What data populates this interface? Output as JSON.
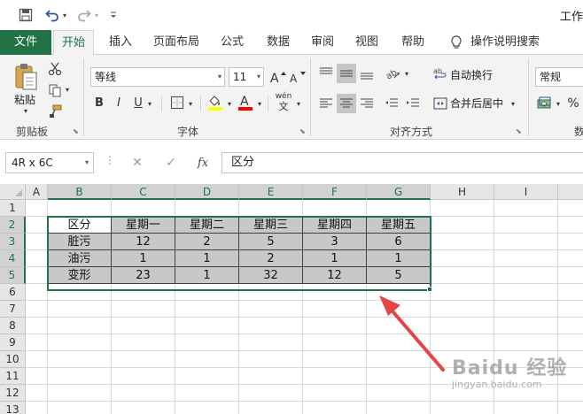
{
  "window": {
    "title": "工作"
  },
  "qat": {
    "save": "save-icon",
    "undo": "undo-icon",
    "redo": "redo-icon",
    "customize": "chevron-down-icon"
  },
  "tabs": [
    "文件",
    "开始",
    "插入",
    "页面布局",
    "公式",
    "数据",
    "审阅",
    "视图",
    "帮助",
    "操作说明搜索"
  ],
  "ribbon": {
    "clipboard": {
      "paste_label": "粘贴",
      "group_label": "剪贴板"
    },
    "font": {
      "font_name": "等线",
      "font_size": "11",
      "bold": "B",
      "italic": "I",
      "underline": "U",
      "phonetic": "wén",
      "phonetic_sub": "文",
      "group_label": "字体",
      "fill_color": "#ffff00",
      "font_color": "#ff0000"
    },
    "alignment": {
      "wrap_text": "自动换行",
      "merge_center": "合并后居中",
      "group_label": "对齐方式"
    },
    "number": {
      "format": "常规",
      "percent": "%",
      "group_label": "数"
    }
  },
  "formula_bar": {
    "name_box": "4R x 6C",
    "content": "区分",
    "fx": "fx"
  },
  "grid": {
    "columns": [
      "A",
      "B",
      "C",
      "D",
      "E",
      "F",
      "G",
      "H",
      "I"
    ],
    "rows": [
      "1",
      "2",
      "3",
      "4",
      "5",
      "6",
      "7",
      "8",
      "9",
      "10",
      "11",
      "12",
      "13"
    ],
    "table": {
      "header": [
        "区分",
        "星期一",
        "星期二",
        "星期三",
        "星期四",
        "星期五"
      ],
      "body": [
        [
          "脏污",
          "12",
          "2",
          "5",
          "3",
          "6"
        ],
        [
          "油污",
          "1",
          "1",
          "2",
          "1",
          "1"
        ],
        [
          "变形",
          "23",
          "1",
          "32",
          "12",
          "5"
        ]
      ]
    }
  },
  "watermark": {
    "text": "Baidu 经验",
    "sub": "jingyan.baidu.com"
  },
  "colors": {
    "excel_green": "#217346",
    "annotation_arrow": "#e64545"
  }
}
